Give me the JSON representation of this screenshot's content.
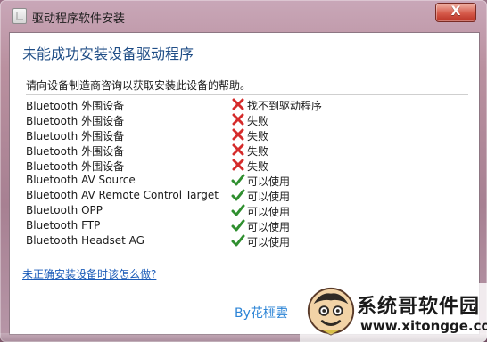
{
  "window": {
    "title": "驱动程序软件安装",
    "close_label": "X"
  },
  "content": {
    "heading": "未能成功安装设备驱动程序",
    "subtext": "请向设备制造商咨询以获取安装此设备的帮助。",
    "help_link": "未正确安装设备时该怎么做?",
    "credit": "By花榧雲"
  },
  "devices": [
    {
      "name": "Bluetooth 外围设备",
      "status": "找不到驱动程序",
      "icon": "error-icon"
    },
    {
      "name": "Bluetooth 外围设备",
      "status": "失败",
      "icon": "error-icon"
    },
    {
      "name": "Bluetooth 外围设备",
      "status": "失败",
      "icon": "error-icon"
    },
    {
      "name": "Bluetooth 外围设备",
      "status": "失败",
      "icon": "error-icon"
    },
    {
      "name": "Bluetooth 外围设备",
      "status": "失败",
      "icon": "error-icon"
    },
    {
      "name": "Bluetooth AV Source",
      "status": "可以使用",
      "icon": "check-icon"
    },
    {
      "name": "Bluetooth AV Remote Control Target",
      "status": "可以使用",
      "icon": "check-icon"
    },
    {
      "name": "Bluetooth OPP",
      "status": "可以使用",
      "icon": "check-icon"
    },
    {
      "name": "Bluetooth FTP",
      "status": "可以使用",
      "icon": "check-icon"
    },
    {
      "name": "Bluetooth Headset AG",
      "status": "可以使用",
      "icon": "check-icon"
    }
  ],
  "watermark": {
    "brand": "系统哥软件园",
    "url": "www.xitongge.com"
  },
  "colors": {
    "heading": "#1f4d86",
    "link": "#1a5bb8",
    "credit": "#2c84d6",
    "error": "#d52b2b",
    "success": "#2f8f2f"
  }
}
